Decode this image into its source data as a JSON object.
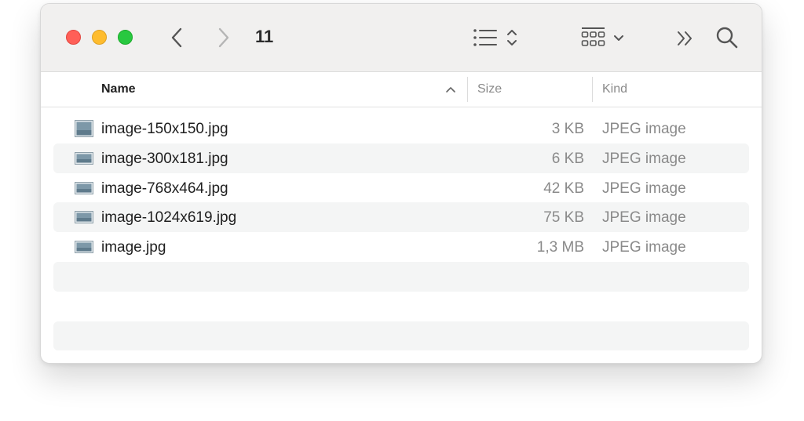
{
  "window": {
    "title": "11"
  },
  "toolbar": {
    "back_icon": "chevron-left-icon",
    "forward_icon": "chevron-right-icon",
    "view_icon": "list-view-icon",
    "group_icon": "grid-group-icon",
    "more_icon": "double-chevron-icon",
    "search_icon": "magnifier-icon"
  },
  "columns": {
    "name": "Name",
    "size": "Size",
    "kind": "Kind"
  },
  "files": [
    {
      "name": "image-150x150.jpg",
      "size": "3 KB",
      "kind": "JPEG image"
    },
    {
      "name": "image-300x181.jpg",
      "size": "6 KB",
      "kind": "JPEG image"
    },
    {
      "name": "image-768x464.jpg",
      "size": "42 KB",
      "kind": "JPEG image"
    },
    {
      "name": "image-1024x619.jpg",
      "size": "75 KB",
      "kind": "JPEG image"
    },
    {
      "name": "image.jpg",
      "size": "1,3 MB",
      "kind": "JPEG image"
    }
  ],
  "colors": {
    "close": "#ff5f57",
    "minimize": "#febc2e",
    "maximize": "#28c840",
    "toolbar_bg": "#f1f0ef",
    "row_alt": "#f4f5f5"
  }
}
